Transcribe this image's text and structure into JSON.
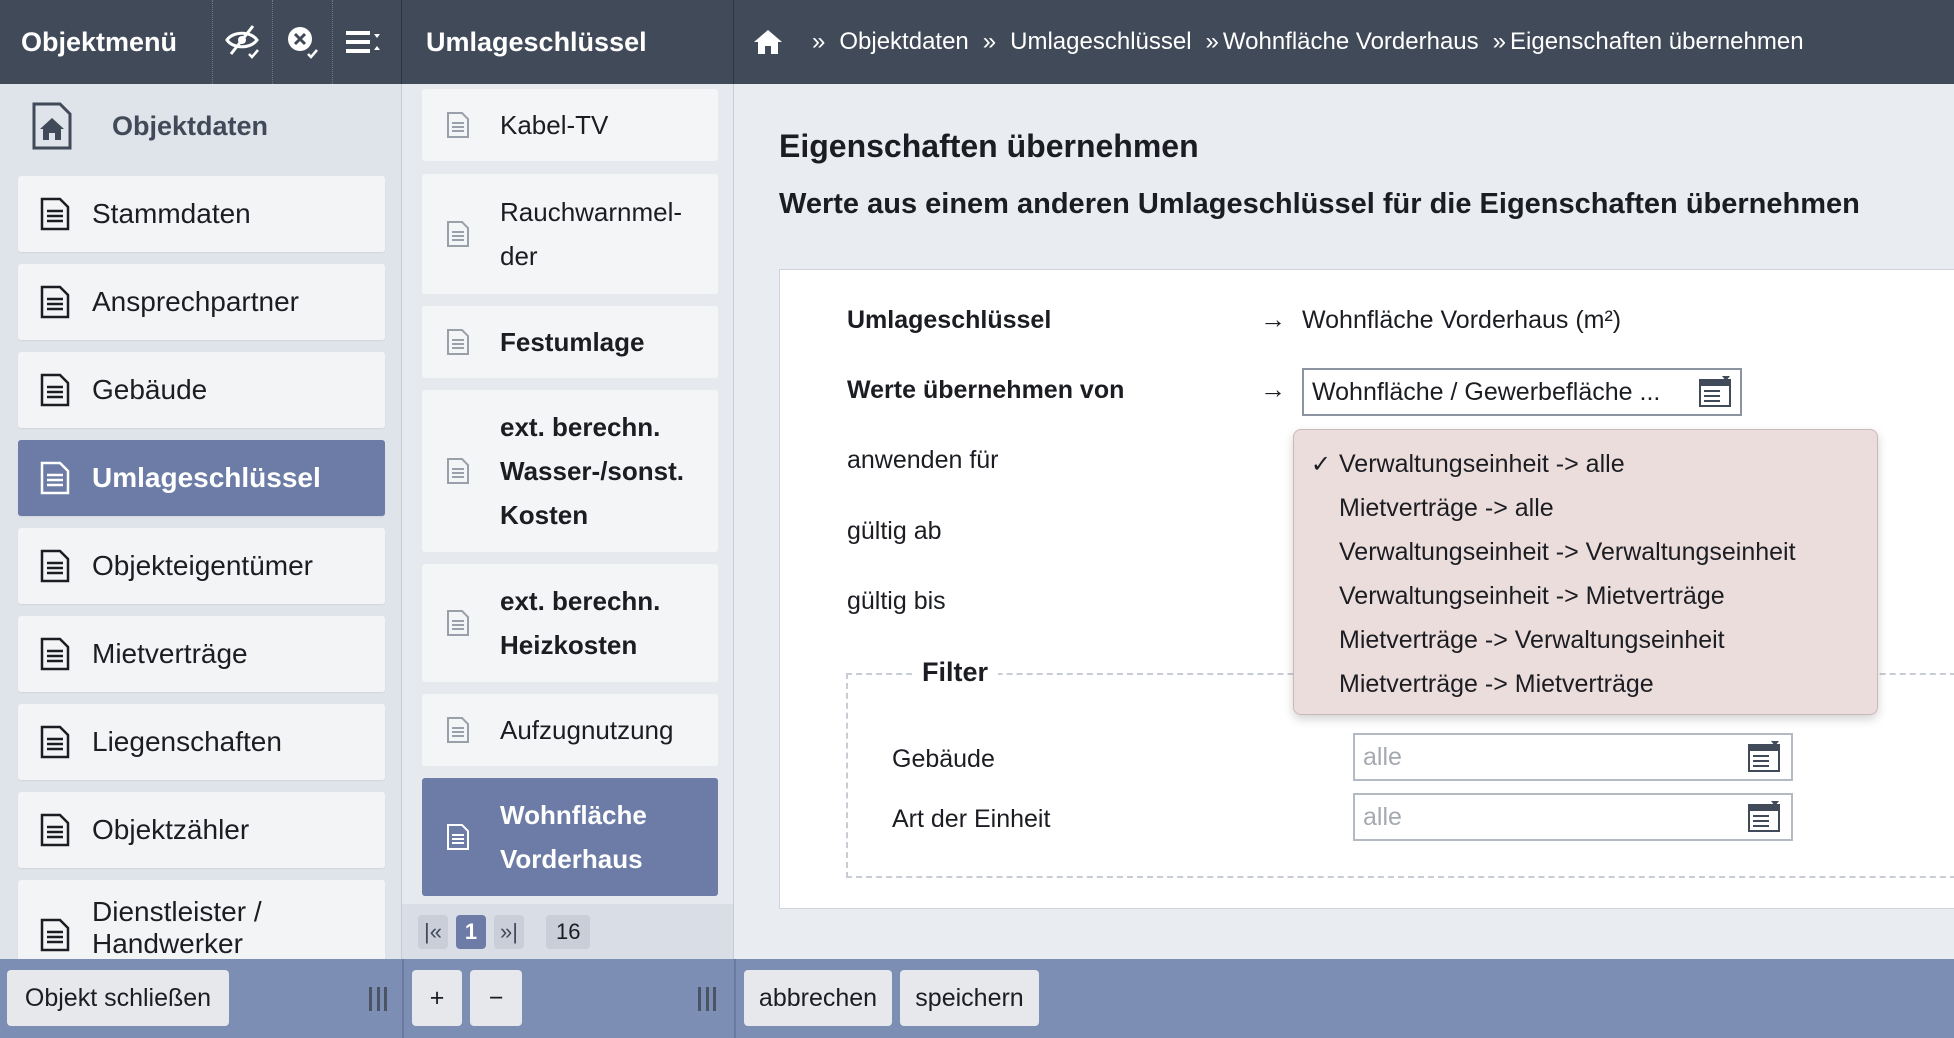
{
  "header": {
    "object_menu_title": "Objektmenü",
    "keys_title": "Umlageschlüssel",
    "breadcrumb": {
      "separator": "»",
      "items": [
        "Objektdaten",
        "Umlageschlüssel",
        "Wohnfläche Vorderhaus",
        "Eigenschaften übernehmen"
      ]
    }
  },
  "sidebar": {
    "heading": "Objektdaten",
    "items": [
      {
        "label": "Stammdaten"
      },
      {
        "label": "Ansprechpartner"
      },
      {
        "label": "Gebäude"
      },
      {
        "label": "Umlageschlüssel"
      },
      {
        "label": "Objekteigentümer"
      },
      {
        "label": "Mietverträge"
      },
      {
        "label": "Liegenschaften"
      },
      {
        "label": "Objektzähler"
      },
      {
        "label": "Dienstleister / Handwerker"
      }
    ]
  },
  "keys": {
    "items": [
      {
        "label": "Kabel-TV"
      },
      {
        "label": "Rauchwarnmel-der"
      },
      {
        "label": "Festumlage"
      },
      {
        "label": "ext. berechn. Wasser-/sonst. Kosten"
      },
      {
        "label": "ext. berechn. Heizkosten"
      },
      {
        "label": "Aufzugnutzung"
      },
      {
        "label": "Wohnfläche Vorderhaus"
      }
    ],
    "pager": {
      "first": "|«",
      "current": "1",
      "last": "»|",
      "total": "16"
    }
  },
  "main": {
    "title": "Eigenschaften übernehmen",
    "subtitle": "Werte aus einem anderen Umlageschlüssel für die Eigenschaften übernehmen",
    "arrow": "→",
    "rows": {
      "key_label": "Umlageschlüssel",
      "key_value": "Wohnfläche Vorderhaus (m²)",
      "copy_label": "Werte übernehmen von",
      "copy_value": "Wohnfläche / Gewerbefläche ...",
      "apply_label": "anwenden für",
      "valid_from_label": "gültig ab",
      "valid_to_label": "gültig bis"
    },
    "filter": {
      "legend": "Filter",
      "building_label": "Gebäude",
      "building_value": "alle",
      "unit_type_label": "Art der Einheit",
      "unit_type_value": "alle"
    },
    "dropdown": {
      "check": "✓",
      "options": [
        {
          "label": "Verwaltungseinheit -> alle"
        },
        {
          "label": "Mietverträge -> alle"
        },
        {
          "label": "Verwaltungseinheit -> Verwaltungseinheit"
        },
        {
          "label": "Verwaltungseinheit -> Mietverträge"
        },
        {
          "label": "Mietverträge -> Verwaltungseinheit"
        },
        {
          "label": "Mietverträge -> Mietverträge"
        }
      ]
    }
  },
  "footer": {
    "close_object": "Objekt schließen",
    "add": "+",
    "remove": "−",
    "cancel": "abbrechen",
    "save": "speichern"
  }
}
